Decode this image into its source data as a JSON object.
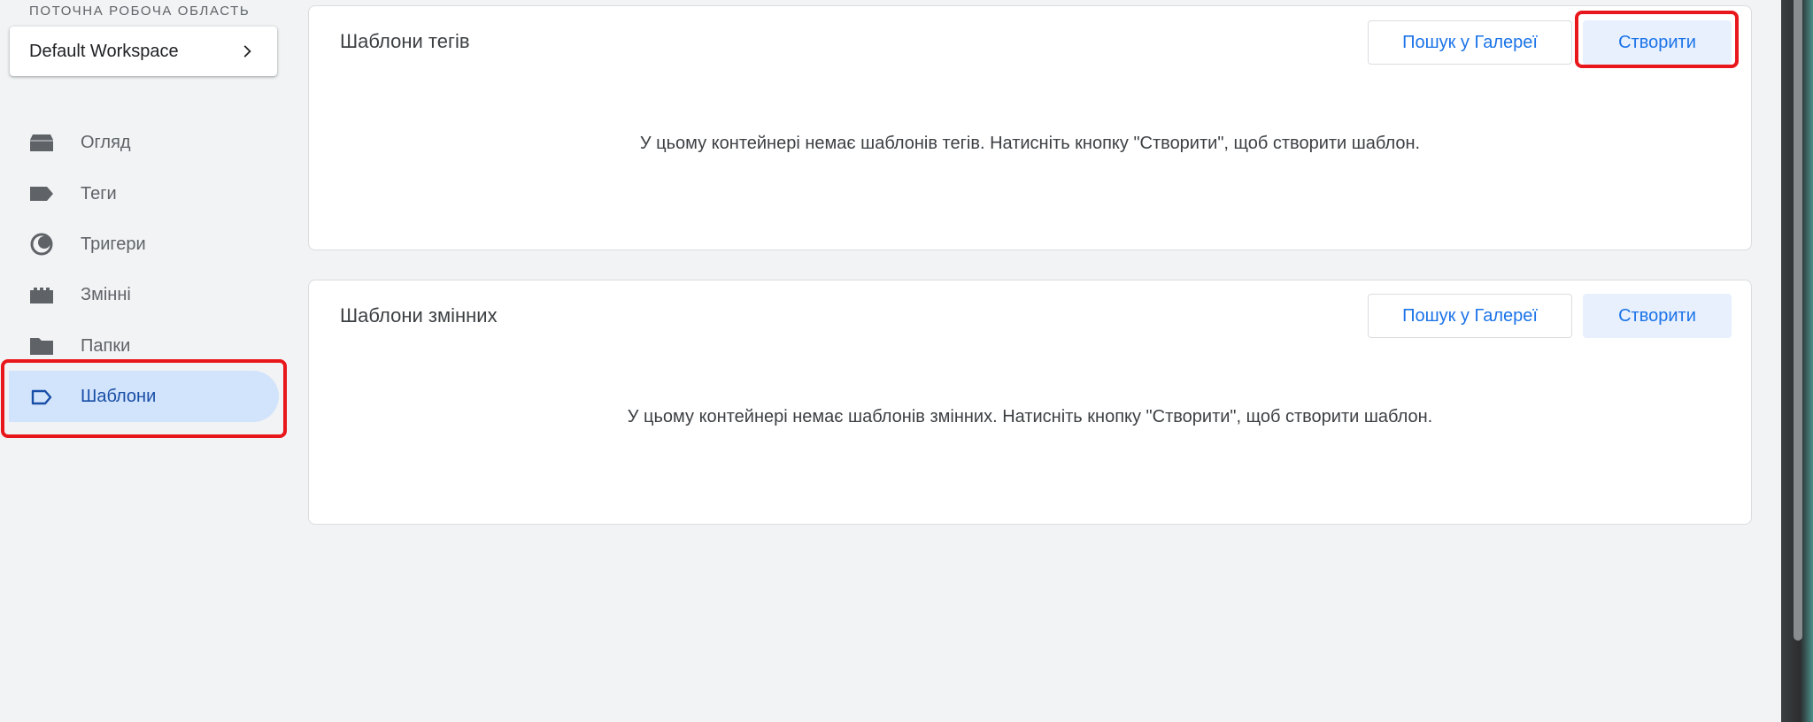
{
  "workspace": {
    "label": "ПОТОЧНА РОБОЧА ОБЛАСТЬ",
    "name": "Default Workspace"
  },
  "nav": {
    "items": [
      {
        "label": "Огляд",
        "icon": "overview-icon"
      },
      {
        "label": "Теги",
        "icon": "tag-icon"
      },
      {
        "label": "Тригери",
        "icon": "trigger-icon"
      },
      {
        "label": "Змінні",
        "icon": "variable-icon"
      },
      {
        "label": "Папки",
        "icon": "folder-icon"
      },
      {
        "label": "Шаблони",
        "icon": "template-icon",
        "active": true
      }
    ]
  },
  "tag_templates": {
    "title": "Шаблони тегів",
    "search_label": "Пошук у Галереї",
    "create_label": "Створити",
    "empty_message": "У цьому контейнері немає шаблонів тегів. Натисніть кнопку \"Створити\", щоб створити шаблон."
  },
  "variable_templates": {
    "title": "Шаблони змінних",
    "search_label": "Пошук у Галереї",
    "create_label": "Створити",
    "empty_message": "У цьому контейнері немає шаблонів змінних. Натисніть кнопку \"Створити\", щоб створити шаблон."
  },
  "colors": {
    "accent": "#1a73e8",
    "active_nav_bg": "#d2e3fc",
    "highlight": "#e8171b"
  }
}
